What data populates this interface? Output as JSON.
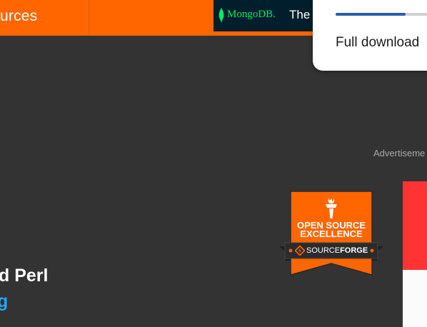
{
  "header": {
    "nav_label": "urces"
  },
  "ad_banner": {
    "brand": "MongoDB.",
    "cta_text": "The b",
    "colors": {
      "background": "#001e2b",
      "brand": "#00ed64"
    },
    "icon": "mongodb-leaf-icon"
  },
  "download_popup": {
    "progress": 0.65,
    "title": "Full download"
  },
  "advertisement_label": "Advertiseme",
  "badge": {
    "line1": "OPEN SOURCE",
    "line2": "EXCELLENCE",
    "ribbon_source": "SOURCE",
    "ribbon_forge": "FORGE",
    "icon": "torch-icon",
    "ribbon_icon": "sourceforge-diamond-icon"
  },
  "project": {
    "title": "d Perl",
    "link": "g"
  },
  "colors": {
    "accent": "#ff6600",
    "page_background": "#333333",
    "link": "#2aa3e8"
  }
}
